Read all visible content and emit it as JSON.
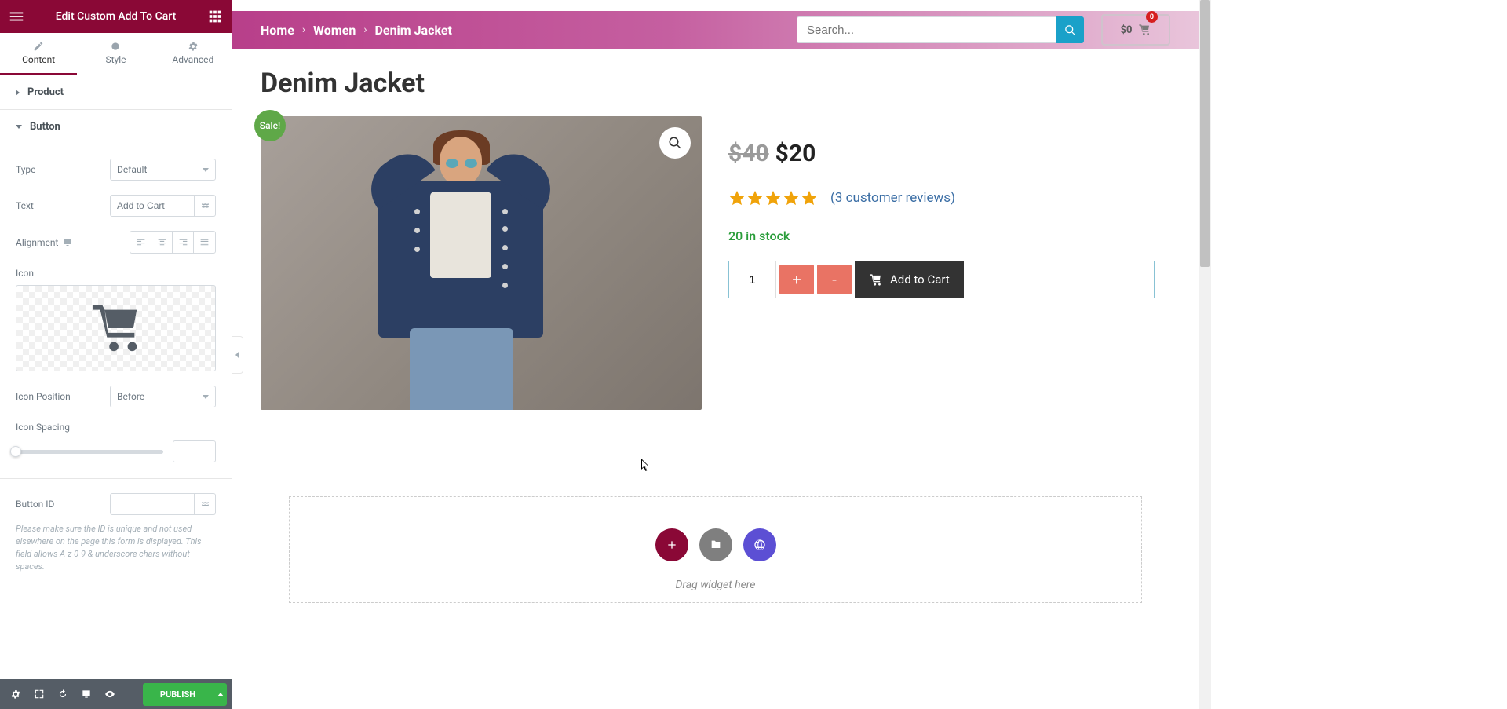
{
  "sidebar": {
    "title": "Edit Custom Add To Cart",
    "tabs": {
      "content": "Content",
      "style": "Style",
      "advanced": "Advanced"
    },
    "sections": {
      "product": "Product",
      "button": "Button"
    },
    "controls": {
      "type_label": "Type",
      "type_value": "Default",
      "text_label": "Text",
      "text_value": "Add to Cart",
      "alignment_label": "Alignment",
      "icon_label": "Icon",
      "icon_position_label": "Icon Position",
      "icon_position_value": "Before",
      "icon_spacing_label": "Icon Spacing",
      "button_id_label": "Button ID",
      "button_id_value": "",
      "button_id_help": "Please make sure the ID is unique and not used elsewhere on the page this form is displayed. This field allows A-z 0-9 & underscore chars without spaces."
    },
    "publish": "PUBLISH"
  },
  "preview": {
    "breadcrumb": [
      "Home",
      "Women",
      "Denim Jacket"
    ],
    "search_placeholder": "Search...",
    "cart_summary": {
      "amount": "$0",
      "count": "0"
    },
    "product": {
      "title": "Denim Jacket",
      "sale_badge": "Sale!",
      "old_price": "$40",
      "new_price": "$20",
      "reviews": "(3 customer reviews)",
      "stock": "20 in stock",
      "qty": "1",
      "plus": "+",
      "minus": "-",
      "add_button": "Add to Cart"
    },
    "drop_text": "Drag widget here"
  },
  "colors": {
    "primary": "#8a0836",
    "accent_teal": "#1aa1c9",
    "accent_coral": "#e97364",
    "success": "#39b54a",
    "star": "#f0a30a"
  }
}
